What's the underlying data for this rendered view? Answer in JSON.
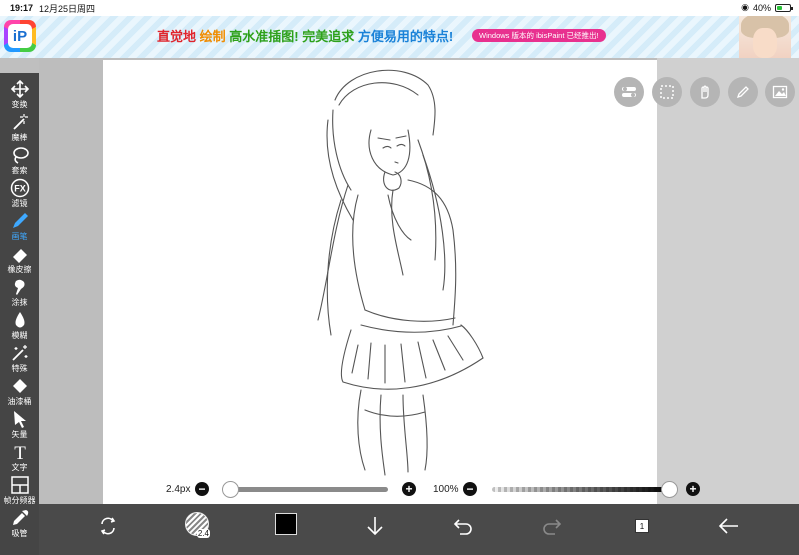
{
  "status_bar": {
    "time": "19:17",
    "date": "12月25日周四",
    "battery": "40%",
    "battery_level": 0.4
  },
  "ad": {
    "slogan_1": "直觉地",
    "slogan_2": "绘制",
    "slogan_3": "高水准插图!",
    "slogan_4": "完美追求",
    "slogan_5": "方便易用的特点!",
    "pill": "Windows 版本的 ibisPaint 已经推出!",
    "logo_letter": "iP"
  },
  "toolbar": {
    "items": [
      {
        "label": "变换",
        "icon": "move-icon"
      },
      {
        "label": "魔棒",
        "icon": "magic-wand-icon"
      },
      {
        "label": "套索",
        "icon": "lasso-icon"
      },
      {
        "label": "滤镜",
        "icon": "fx-icon",
        "icon_text": "FX"
      },
      {
        "label": "画笔",
        "icon": "brush-icon",
        "active": true
      },
      {
        "label": "橡皮擦",
        "icon": "eraser-icon"
      },
      {
        "label": "涂抹",
        "icon": "smudge-icon"
      },
      {
        "label": "模糊",
        "icon": "blur-icon"
      },
      {
        "label": "特殊",
        "icon": "special-icon"
      },
      {
        "label": "油漆桶",
        "icon": "bucket-icon"
      },
      {
        "label": "矢量",
        "icon": "vector-icon"
      },
      {
        "label": "文字",
        "icon": "text-icon",
        "icon_text": "T"
      },
      {
        "label": "帧分频器",
        "icon": "frame-divider-icon"
      },
      {
        "label": "吸管",
        "icon": "eyedropper-icon"
      }
    ]
  },
  "brush": {
    "size_label": "2.4px",
    "opacity_label": "100%",
    "size_fraction": 0.0,
    "opacity_fraction": 1.0,
    "preview_label": "2.4"
  },
  "colors": {
    "accent": "#3fa9ff",
    "toolbar_bg": "#454545",
    "bottom_bg": "#4a4a4a",
    "current_color": "#000000"
  },
  "bottom_bar": {
    "layer_count": "1"
  }
}
